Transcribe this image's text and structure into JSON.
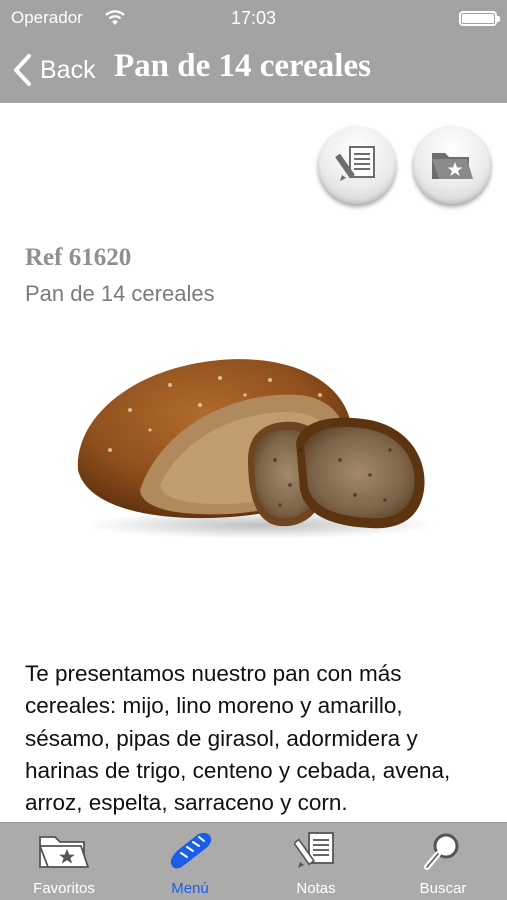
{
  "status_bar": {
    "carrier": "Operador",
    "time": "17:03"
  },
  "nav": {
    "back_label": "Back",
    "title": "Pan de 14 cereales"
  },
  "product": {
    "ref": "Ref 61620",
    "name": "Pan de 14 cereales",
    "description": "Te presentamos nuestro pan con más cereales: mijo, lino moreno y amarillo, sésamo, pipas de girasol, adormidera y harinas de trigo, centeno y cebada, avena, arroz, espelta, sarraceno y corn."
  },
  "actions": [
    {
      "icon": "notes-icon"
    },
    {
      "icon": "folder-star-icon"
    }
  ],
  "tabs": [
    {
      "label": "Favoritos",
      "icon": "folder-star-icon",
      "active": false
    },
    {
      "label": "Menú",
      "icon": "baguette-icon",
      "active": true
    },
    {
      "label": "Notas",
      "icon": "notes-icon",
      "active": false
    },
    {
      "label": "Buscar",
      "icon": "search-icon",
      "active": false
    }
  ],
  "colors": {
    "header": "#a3a3a3",
    "tabbar": "#ababab",
    "active_tab": "#1a5ee8"
  }
}
